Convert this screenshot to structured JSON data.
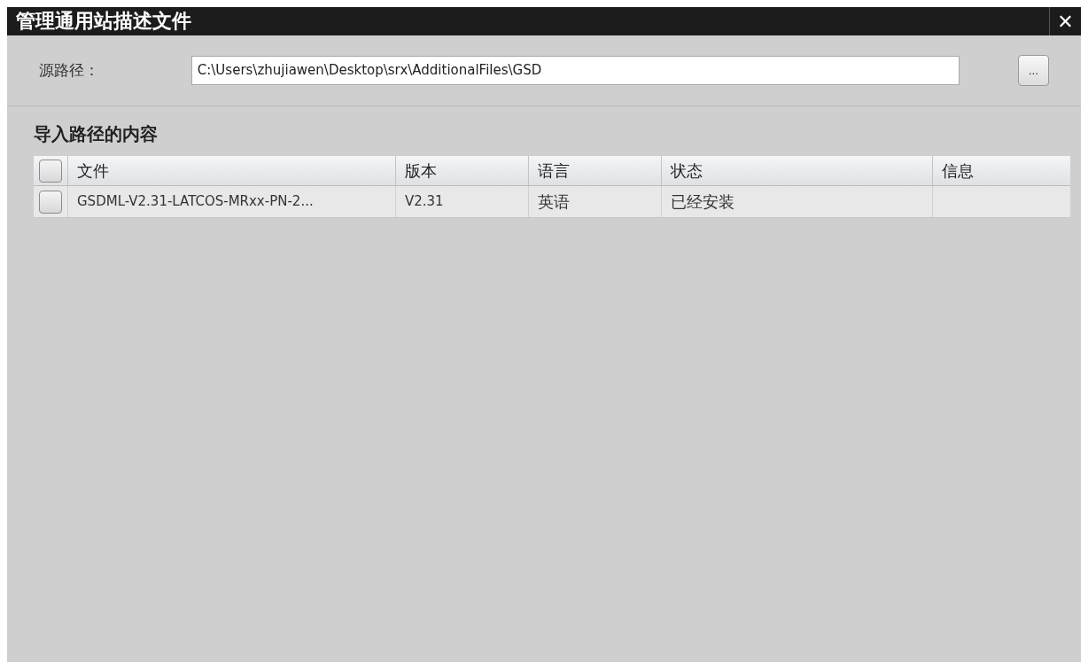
{
  "window": {
    "title": "管理通用站描述文件",
    "close": "✕"
  },
  "source": {
    "label": "源路径：",
    "value": "C:\\Users\\zhujiawen\\Desktop\\srx\\AdditionalFiles\\GSD",
    "browse": "..."
  },
  "section": {
    "title": "导入路径的内容"
  },
  "table": {
    "header_checked": false,
    "columns": [
      "文件",
      "版本",
      "语言",
      "状态",
      "信息"
    ],
    "rows": [
      {
        "checked": false,
        "cells": [
          "GSDML-V2.31-LATCOS-MRxx-PN-2...",
          "V2.31",
          "英语",
          "已经安装",
          ""
        ]
      }
    ]
  }
}
